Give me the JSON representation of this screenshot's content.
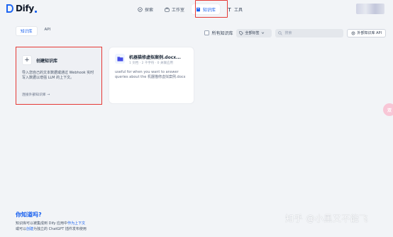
{
  "app": {
    "logo_text": "Dify"
  },
  "nav": [
    {
      "label": "探索",
      "icon": "compass-icon"
    },
    {
      "label": "工作室",
      "icon": "studio-icon"
    },
    {
      "label": "知识库",
      "icon": "book-icon",
      "active": true
    },
    {
      "label": "工具",
      "icon": "tool-icon"
    }
  ],
  "tabs": [
    {
      "label": "知识库",
      "active": true
    },
    {
      "label": "API"
    }
  ],
  "toolbar": {
    "all_kb_label": "所有知识库",
    "tag_filter_label": "全部标签",
    "search_placeholder": "搜索",
    "external_api_label": "外部知识库 API"
  },
  "create_card": {
    "title": "创建知识库",
    "description": "导入您自己的文本数据或通过 Webhook 实时写入数据以增强 LLM 的上下文。",
    "link_label": "连接外部知识库 →"
  },
  "doc_card": {
    "title": "机器猫修虚拟案例.docx...",
    "meta": "1 文档 · 2 千字符 · 0 关联应用",
    "description": "useful for when you want to answer queries about the 机器猫修虚拟案例.docx"
  },
  "side_bubble": {
    "label": "双"
  },
  "tips": {
    "title": "你知道吗?",
    "line1_prefix": "知识库可以被集成到 Dify 应用中",
    "line1_link": "作为上下文",
    "line2_prefix": "或可以",
    "line2_link": "创建",
    "line2_suffix": "为独立的 ChatGPT 插件发布使用"
  },
  "watermark": {
    "text": "知乎 @小黑又不能飞"
  },
  "colors": {
    "accent": "#155eef",
    "highlight": "#e53935"
  }
}
